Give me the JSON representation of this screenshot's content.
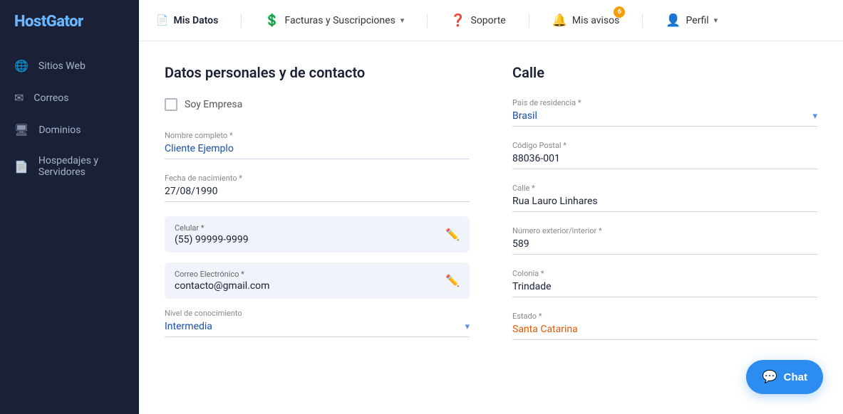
{
  "brand": "HostGator",
  "sidebar": {
    "items": [
      {
        "id": "sitios-web",
        "label": "Sitios Web",
        "icon": "🌐"
      },
      {
        "id": "correos",
        "label": "Correos",
        "icon": "✉"
      },
      {
        "id": "dominios",
        "label": "Dominios",
        "icon": "🖥"
      },
      {
        "id": "hospedajes",
        "label": "Hospedajes y\nServidores",
        "icon": "📄"
      }
    ]
  },
  "topnav": {
    "items": [
      {
        "id": "mis-datos",
        "label": "Mis Datos",
        "icon": "📄",
        "active": true,
        "hasChevron": false
      },
      {
        "id": "facturas",
        "label": "Facturas y Suscripciones",
        "icon": "💲",
        "active": false,
        "hasChevron": true
      },
      {
        "id": "soporte",
        "label": "Soporte",
        "icon": "❓",
        "active": false,
        "hasChevron": false
      },
      {
        "id": "mis-avisos",
        "label": "Mis avisos",
        "icon": "🔔",
        "active": false,
        "hasChevron": false,
        "badge": "6"
      },
      {
        "id": "perfil",
        "label": "Perfil",
        "icon": "👤",
        "active": false,
        "hasChevron": true
      }
    ]
  },
  "personal": {
    "section_title": "Datos personales y de contacto",
    "empresa_label": "Soy Empresa",
    "nombre_label": "Nombre completo *",
    "nombre_value": "Cliente Ejemplo",
    "fecha_label": "Fecha de nacimiento *",
    "fecha_value": "27/08/1990",
    "celular_label": "Celular *",
    "celular_value": "(55) 99999-9999",
    "correo_label": "Correo Electrónico *",
    "correo_value": "contacto@gmail.com",
    "nivel_label": "Nivel de conocimiento",
    "nivel_value": "Intermedia"
  },
  "address": {
    "section_title": "Calle",
    "pais_label": "País de residencia *",
    "pais_value": "Brasil",
    "postal_label": "Código Postal *",
    "postal_value": "88036-001",
    "calle_label": "Calle *",
    "calle_value": "Rua Lauro Linhares",
    "numero_label": "Número exterior/interior *",
    "numero_value": "589",
    "colonia_label": "Colonia *",
    "colonia_value": "Trindade",
    "estado_label": "Estado *",
    "estado_value": "Santa Catarina"
  },
  "chat": {
    "label": "Chat",
    "icon": "💬"
  }
}
